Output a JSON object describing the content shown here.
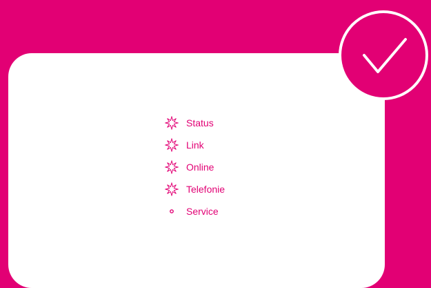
{
  "colors": {
    "accent": "#e20074",
    "background": "#e20074",
    "card": "#ffffff"
  },
  "status_badge": {
    "icon": "checkmark-icon"
  },
  "status_list": [
    {
      "label": "Status",
      "icon": "blinking-led-icon"
    },
    {
      "label": "Link",
      "icon": "blinking-led-icon"
    },
    {
      "label": "Online",
      "icon": "blinking-led-icon"
    },
    {
      "label": "Telefonie",
      "icon": "blinking-led-icon"
    },
    {
      "label": "Service",
      "icon": "led-off-icon"
    }
  ]
}
